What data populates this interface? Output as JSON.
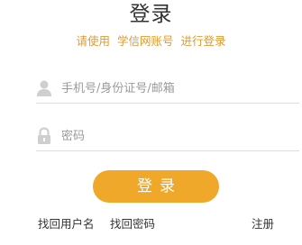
{
  "header": {
    "title": "登录",
    "subtitle": "请使用  学信网账号  进行登录"
  },
  "form": {
    "username": {
      "icon": "user-icon",
      "placeholder": "手机号/身份证号/邮箱",
      "value": ""
    },
    "password": {
      "icon": "lock-icon",
      "placeholder": "密码",
      "value": ""
    },
    "login_label": "登录"
  },
  "footer": {
    "recover_username": "找回用户名",
    "recover_password": "找回密码",
    "register": "注册"
  },
  "colors": {
    "accent": "#f0a82a",
    "subtitle": "#e09a2c",
    "icon": "#cfcfcf"
  }
}
